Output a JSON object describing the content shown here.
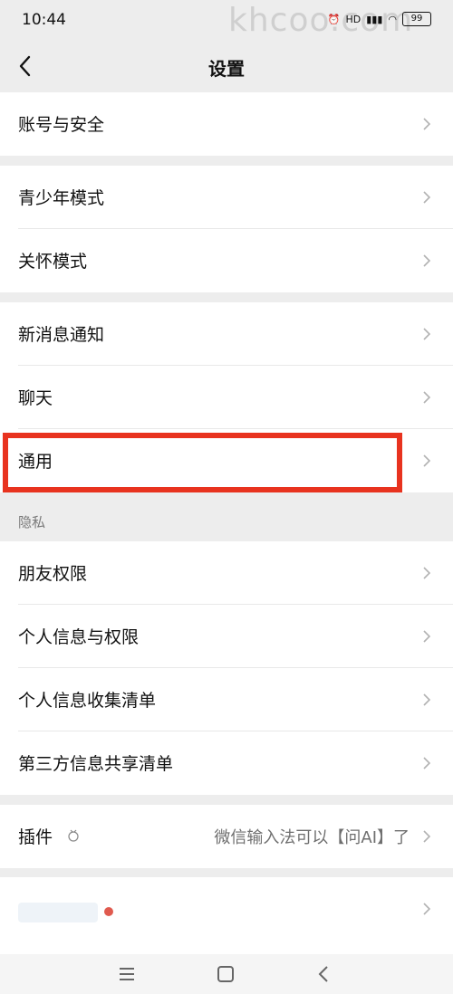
{
  "status": {
    "time": "10:44",
    "watermark": "khcoo.com",
    "net_label": "HD",
    "battery": "99"
  },
  "header": {
    "title": "设置"
  },
  "groups": {
    "account": [
      "账号与安全"
    ],
    "mode": [
      "青少年模式",
      "关怀模式"
    ],
    "general": [
      "新消息通知",
      "聊天",
      "通用"
    ],
    "privacy_label": "隐私",
    "privacy": [
      "朋友权限",
      "个人信息与权限",
      "个人信息收集清单",
      "第三方信息共享清单"
    ],
    "plugin": {
      "label": "插件",
      "desc": "微信输入法可以【问AI】了"
    }
  },
  "colors": {
    "highlight": "#e8331f",
    "background": "#ededed",
    "red_dot": "#e05a4e"
  }
}
